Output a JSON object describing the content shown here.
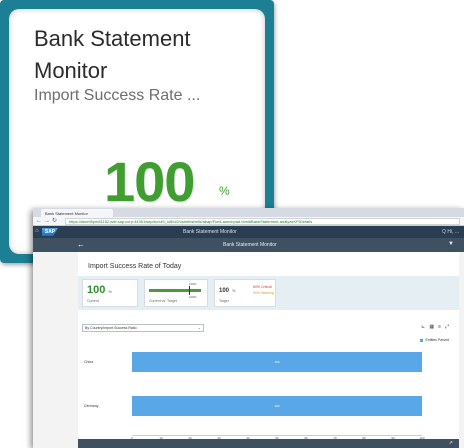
{
  "tile": {
    "title": "Bank Statement Monitor",
    "subtitle": "Import Success Rate ...",
    "kpi_value": "100",
    "kpi_unit": "%",
    "colors": {
      "frame": "#1d7f93",
      "kpi": "#3f9e2f"
    }
  },
  "browser": {
    "tab_title": "Bank Statement Monitor",
    "url": "https://ldcmf5pm81162.wdf.sap.corp:44361/sap/bc/ui5_ui5/ui2/ushell/shells/abap/FioriLaunchpad.html#BankStatement-analyzeKPIDetails",
    "shell_logo": "SAP",
    "shell_title": "Bank Statement Monitor",
    "shell_user": "Q  Hi, ..."
  },
  "app": {
    "header_title": "Bank Statement Monitor",
    "page_title": "Import Success Rate of Today",
    "kpi_cards": [
      {
        "value": "100",
        "unit": "%",
        "label": "Current"
      },
      {
        "label": "Current vs. Target",
        "target_text": "100%",
        "current_text": "100%",
        "progress_percent": 100
      },
      {
        "value": "100",
        "unit": "%",
        "label": "Target",
        "thresholds": [
          {
            "label": "80% Critical",
            "color": "#dd3333"
          },
          {
            "label": "90% Warning",
            "color": "#e39b1b"
          }
        ]
      }
    ],
    "dimension_select": "By Country/Import Success Ratio",
    "chart_legend": "Entities Parsed",
    "footer_icon": "share-icon"
  },
  "chart_data": {
    "type": "bar",
    "orientation": "horizontal",
    "categories": [
      "China",
      "Germany"
    ],
    "series": [
      {
        "name": "Entities Parsed",
        "values": [
          100,
          100
        ],
        "color": "#5aa7e8"
      }
    ],
    "xlim": [
      0,
      100
    ],
    "xticks": [
      "0",
      "10",
      "20",
      "30",
      "40",
      "50",
      "60",
      "70",
      "80",
      "90",
      "100"
    ],
    "value_labels": [
      "100",
      "100"
    ],
    "legend_position": "top-right"
  }
}
